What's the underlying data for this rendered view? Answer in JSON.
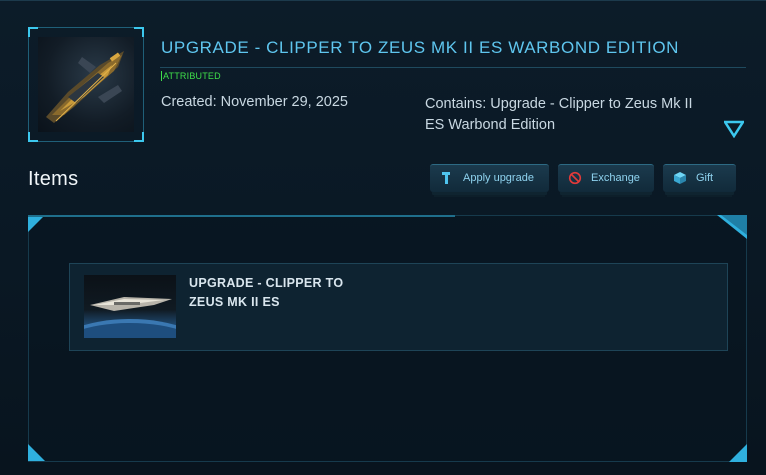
{
  "pledge": {
    "title": "UPGRADE - CLIPPER TO ZEUS MK II ES WARBOND EDITION",
    "status_tag": "ATTRIBUTED",
    "created": "Created: November 29, 2025",
    "contains": "Contains: Upgrade - Clipper to Zeus Mk II ES Warbond Edition",
    "thumbnail_icon": "ship-thumbnail-image",
    "expand_icon": "chevron-down-triangle-icon"
  },
  "items_section": {
    "heading": "Items",
    "actions": [
      {
        "label": "Apply upgrade",
        "icon": "wrench-icon"
      },
      {
        "label": "Exchange",
        "icon": "no-entry-icon"
      },
      {
        "label": "Gift",
        "icon": "gift-box-icon"
      }
    ],
    "items": [
      {
        "name": "UPGRADE - CLIPPER TO ZEUS MK II ES",
        "icon": "ship-planet-image"
      }
    ]
  },
  "colors": {
    "accent": "#5fc6ef",
    "status_green": "#3fe04a",
    "background": "#0b1a26"
  }
}
